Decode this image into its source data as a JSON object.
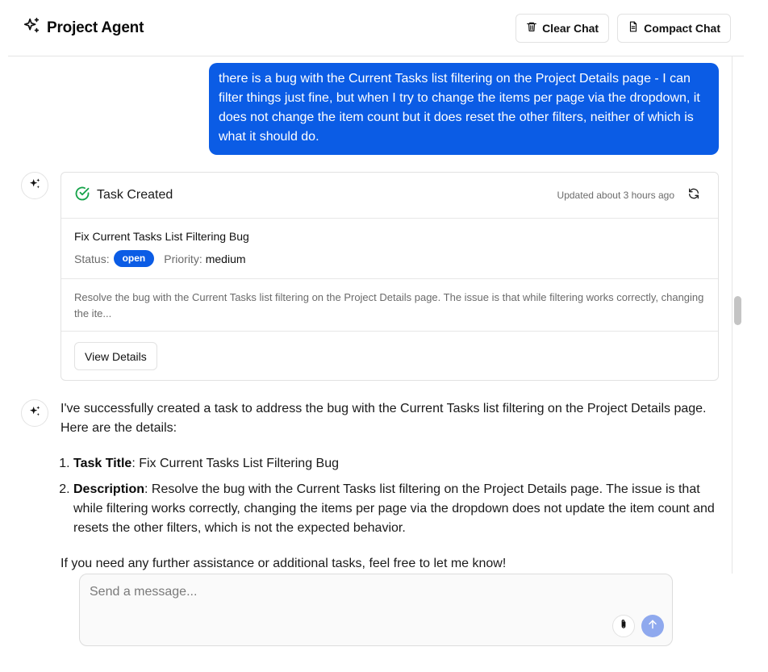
{
  "header": {
    "title": "Project Agent",
    "clear_label": "Clear Chat",
    "compact_label": "Compact Chat"
  },
  "user_message": {
    "text": "there is a bug with the Current Tasks list filtering on the Project Details page - I can filter things just fine, but when I try to change the items per page via the dropdown, it does not change the item count but it does reset the other filters, neither of which is what it should do."
  },
  "task_card": {
    "heading": "Task Created",
    "updated": "Updated about 3 hours ago",
    "task_title": "Fix Current Tasks List Filtering Bug",
    "status_label": "Status:",
    "status_value": "open",
    "priority_label": "Priority:",
    "priority_value": "medium",
    "description": "Resolve the bug with the Current Tasks list filtering on the Project Details page. The issue is that while filtering works correctly, changing the ite...",
    "view_label": "View Details"
  },
  "assistant_message": {
    "intro": "I've successfully created a task to address the bug with the Current Tasks list filtering on the Project Details page. Here are the details:",
    "items": [
      {
        "label": "Task Title",
        "text": ": Fix Current Tasks List Filtering Bug"
      },
      {
        "label": "Description",
        "text": ": Resolve the bug with the Current Tasks list filtering on the Project Details page. The issue is that while filtering works correctly, changing the items per page via the dropdown does not update the item count and resets the other filters, which is not the expected behavior."
      }
    ],
    "outro": "If you need any further assistance or additional tasks, feel free to let me know!"
  },
  "composer": {
    "placeholder": "Send a message...",
    "value": ""
  },
  "colors": {
    "accent": "#0b5ce5",
    "success": "#16a34a",
    "send_disabled": "#8fa9ee"
  },
  "icons": {
    "brand": "sparkles-icon",
    "clear": "trash-icon",
    "compact": "file-text-icon",
    "task_status": "check-circle-icon",
    "refresh": "refresh-icon",
    "attach": "paperclip-icon",
    "send": "arrow-up-icon"
  }
}
